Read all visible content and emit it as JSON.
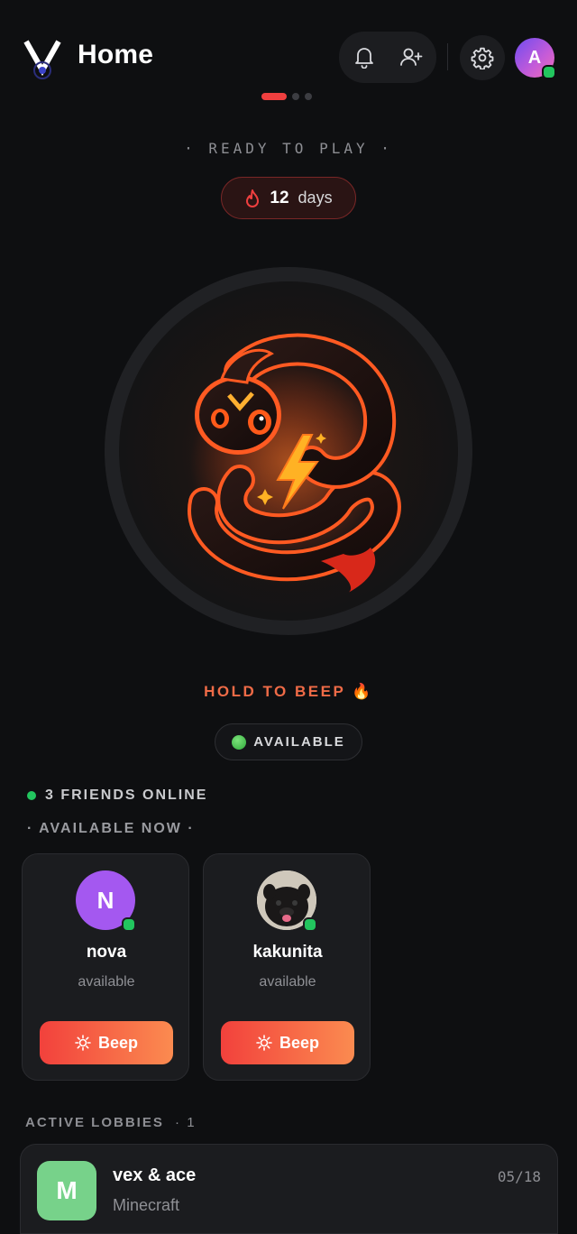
{
  "header": {
    "title": "Home",
    "profile_initial": "A",
    "icons": [
      "bell-icon",
      "add-user-icon",
      "gear-icon"
    ]
  },
  "hero": {
    "ready_label": "· READY TO PLAY ·",
    "streak_count": "12",
    "streak_unit": "days",
    "hold_label": "HOLD TO BEEP 🔥",
    "status_label": "AVAILABLE"
  },
  "friends": {
    "online_label": "3 FRIENDS ONLINE",
    "available_now_label": "· AVAILABLE NOW ·",
    "cards": [
      {
        "name": "nova",
        "status": "available",
        "initial": "N",
        "beep_label": "Beep"
      },
      {
        "name": "kakunita",
        "status": "available",
        "initial": "",
        "beep_label": "Beep"
      }
    ]
  },
  "lobbies": {
    "header_label": "ACTIVE LOBBIES",
    "count": "· 1",
    "items": [
      {
        "name": "vex & ace",
        "game": "Minecraft",
        "date": "05/18",
        "initial": "M"
      }
    ]
  },
  "colors": {
    "accent": "#ef3f3f",
    "online": "#22c55e",
    "beep_start": "#f2413c",
    "beep_end": "#fb8b50",
    "nova_avatar": "#a458f0",
    "lobby_icon": "#77d28a"
  }
}
